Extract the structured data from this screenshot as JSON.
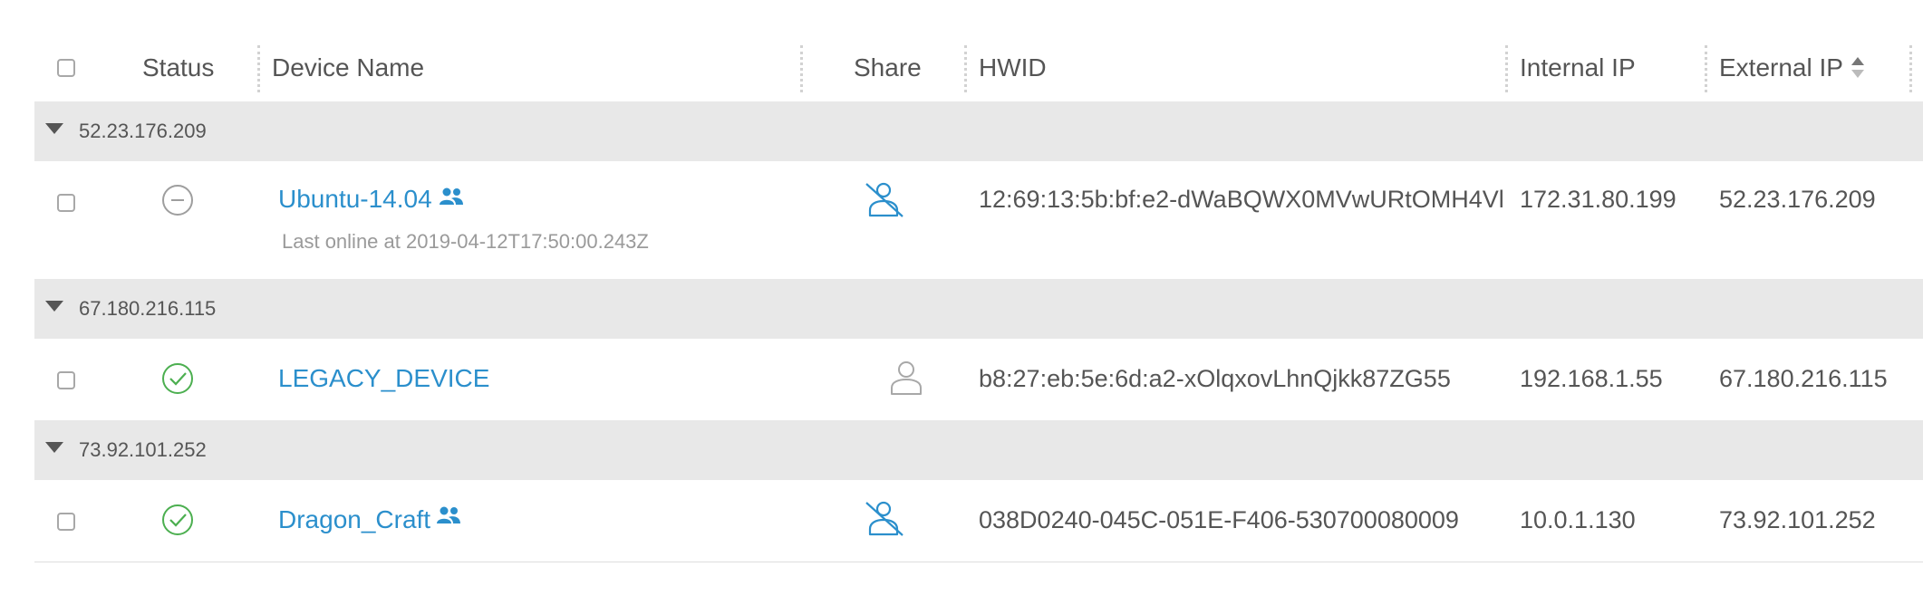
{
  "columns": {
    "status": "Status",
    "device_name": "Device Name",
    "share": "Share",
    "hwid": "HWID",
    "internal_ip": "Internal IP",
    "external_ip": "External IP"
  },
  "groups": [
    {
      "label": "52.23.176.209",
      "device": {
        "status": "offline",
        "name": "Ubuntu-14.04",
        "shared_icon": "people-icon",
        "subtitle": "Last online at 2019-04-12T17:50:00.243Z",
        "share": "share-disabled-icon",
        "hwid": "12:69:13:5b:bf:e2-dWaBQWX0MVwURtOMH4Vl",
        "internal_ip": "172.31.80.199",
        "external_ip": "52.23.176.209"
      }
    },
    {
      "label": "67.180.216.115",
      "device": {
        "status": "online",
        "name": "LEGACY_DEVICE",
        "share": "user-icon",
        "hwid": "b8:27:eb:5e:6d:a2-xOlqxovLhnQjkk87ZG55",
        "internal_ip": "192.168.1.55",
        "external_ip": "67.180.216.115"
      }
    },
    {
      "label": "73.92.101.252",
      "device": {
        "status": "online",
        "name": "Dragon_Craft",
        "shared_icon": "people-icon",
        "share": "share-disabled-icon",
        "hwid": "038D0240-045C-051E-F406-530700080009",
        "internal_ip": "10.0.1.130",
        "external_ip": "73.92.101.252"
      }
    }
  ],
  "colors": {
    "link": "#2b8fcc",
    "online": "#4caf50",
    "offline": "#9e9e9e",
    "group_bg": "#e8e8e8"
  }
}
